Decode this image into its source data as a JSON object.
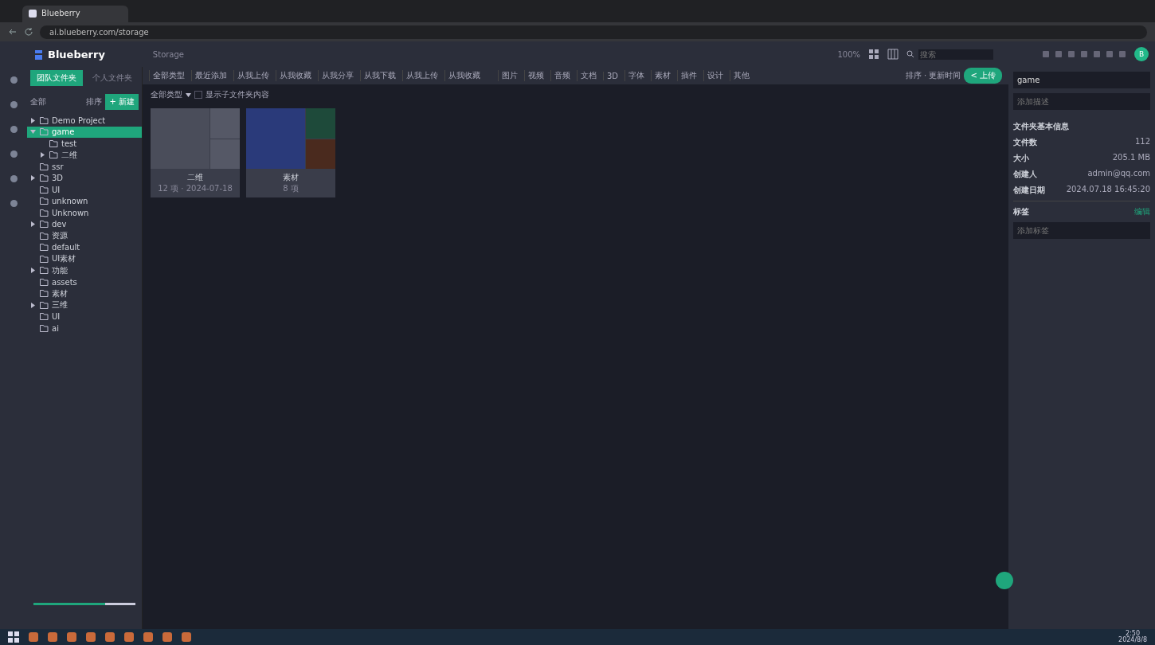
{
  "browser": {
    "tab_title": "Blueberry",
    "url": "ai.blueberry.com/storage"
  },
  "app": {
    "logo": "Blueberry",
    "breadcrumb": "Storage",
    "zoom": "100%",
    "search": {
      "placeholder": "搜索"
    },
    "avatar": "B"
  },
  "left_tabs": [
    {
      "label": "团队文件夹",
      "selected": true
    },
    {
      "label": "个人文件夹",
      "selected": false
    }
  ],
  "tree_header": {
    "label": "全部",
    "sort": "排序",
    "new_button": "+ 新建"
  },
  "tree": [
    {
      "label": "Demo Project",
      "expandable": true,
      "expanded": false,
      "selected": false
    },
    {
      "label": "game",
      "expandable": true,
      "expanded": true,
      "selected": true,
      "children": [
        {
          "label": "test",
          "expandable": false,
          "expanded": false,
          "selected": false
        },
        {
          "label": "二维",
          "expandable": true,
          "expanded": false,
          "selected": false
        }
      ]
    },
    {
      "label": "ssr",
      "expandable": false,
      "expanded": false,
      "selected": false
    },
    {
      "label": "3D",
      "expandable": true,
      "expanded": false,
      "selected": false
    },
    {
      "label": "UI",
      "expandable": false,
      "expanded": false,
      "selected": false
    },
    {
      "label": "unknown",
      "expandable": false,
      "expanded": false,
      "selected": false
    },
    {
      "label": "Unknown",
      "expandable": false,
      "expanded": false,
      "selected": false
    },
    {
      "label": "dev",
      "expandable": true,
      "expanded": false,
      "selected": false
    },
    {
      "label": "资源",
      "expandable": false,
      "expanded": false,
      "selected": false
    },
    {
      "label": "default",
      "expandable": false,
      "expanded": false,
      "selected": false
    },
    {
      "label": "UI素材",
      "expandable": false,
      "expanded": false,
      "selected": false
    },
    {
      "label": "功能",
      "expandable": true,
      "expanded": false,
      "selected": false
    },
    {
      "label": "assets",
      "expandable": false,
      "expanded": false,
      "selected": false
    },
    {
      "label": "素材",
      "expandable": false,
      "expanded": false,
      "selected": false
    },
    {
      "label": "三维",
      "expandable": true,
      "expanded": false,
      "selected": false
    },
    {
      "label": "UI",
      "expandable": false,
      "expanded": false,
      "selected": false
    },
    {
      "label": "ai",
      "expandable": false,
      "expanded": false,
      "selected": false
    }
  ],
  "storage": {
    "level": 0.7
  },
  "filters": [
    "全部类型",
    "最近添加",
    "从我上传",
    "从我收藏",
    "从我分享",
    "从我下载",
    "从我上传",
    "从我收藏"
  ],
  "filters_2": [
    "图片",
    "视频",
    "音频",
    "文档",
    "3D",
    "字体",
    "素材",
    "插件",
    "设计",
    "其他"
  ],
  "toolbar_right": {
    "sort": "排序 · 更新时间",
    "upload_button": "< 上传"
  },
  "sub_filters": {
    "type": "全部类型",
    "option": "显示子文件夹内容",
    "checked": false
  },
  "cards": [
    {
      "title": "二维",
      "meta": "12 项 · 2024-07-18"
    },
    {
      "title": "素材",
      "meta": "8 项"
    }
  ],
  "details": {
    "name": "game",
    "placeholder": "添加描述",
    "section": "文件夹基本信息",
    "rows": [
      {
        "label": "文件数",
        "value": "112"
      },
      {
        "label": "大小",
        "value": "205.1 MB"
      },
      {
        "label": "创建人",
        "value": "admin@qq.com"
      },
      {
        "label": "创建日期",
        "value": "2024.07.18 16:45:20"
      }
    ],
    "tags_label": "标签",
    "tags_link": "编辑",
    "tags_placeholder": "添加标签"
  },
  "taskbar": {
    "time": "2:50",
    "date": "2024/8/8"
  }
}
